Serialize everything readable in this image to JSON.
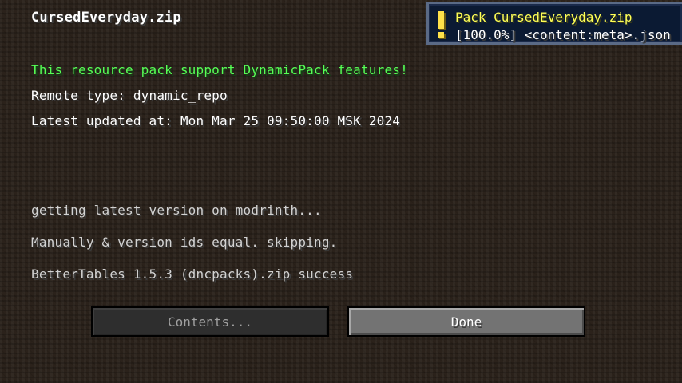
{
  "screen": {
    "title": "CursedEveryday.zip",
    "feature_notice": "This resource pack support DynamicPack features!",
    "remote_type": "Remote type: dynamic_repo",
    "latest_updated": "Latest updated at: Mon Mar 25 09:50:00 MSK 2024"
  },
  "log": [
    "getting latest version on modrinth...",
    "Manually & version ids equal. skipping.",
    "BetterTables 1.5.3 (dncpacks).zip success"
  ],
  "buttons": {
    "contents_label": "Contents...",
    "done_label": "Done"
  },
  "toast": {
    "icon": "warning-exclamation-icon",
    "title": "Pack CursedEveryday.zip",
    "message": "[100.0%] <content:meta>.json"
  },
  "colors": {
    "accent_green": "#55ff55",
    "toast_title_yellow": "#ffff55",
    "toast_background": "#0b1a33"
  }
}
